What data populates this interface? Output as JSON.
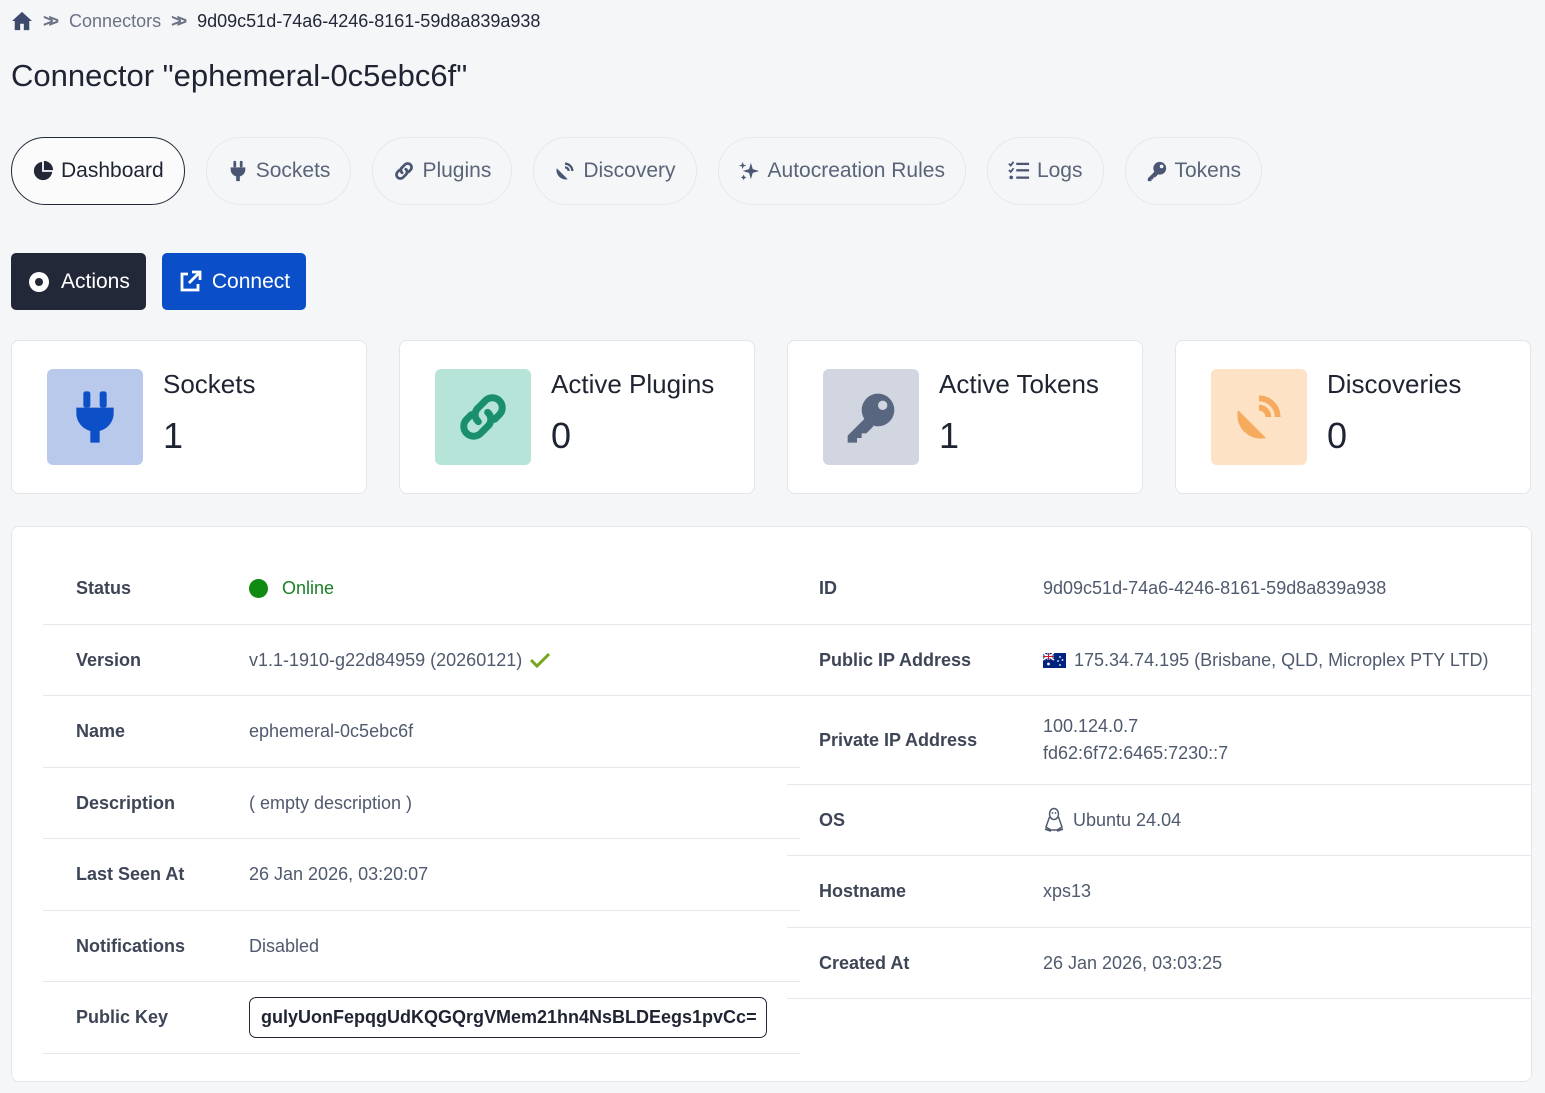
{
  "breadcrumb": {
    "connectors": "Connectors",
    "current": "9d09c51d-74a6-4246-8161-59d8a839a938"
  },
  "page_title": "Connector \"ephemeral-0c5ebc6f\"",
  "tabs": [
    {
      "label": "Dashboard",
      "icon": "pie-chart-icon"
    },
    {
      "label": "Sockets",
      "icon": "plug-icon"
    },
    {
      "label": "Plugins",
      "icon": "link-icon"
    },
    {
      "label": "Discovery",
      "icon": "satellite-dish-icon"
    },
    {
      "label": "Autocreation Rules",
      "icon": "sparkles-icon"
    },
    {
      "label": "Logs",
      "icon": "list-check-icon"
    },
    {
      "label": "Tokens",
      "icon": "key-icon"
    }
  ],
  "actions": {
    "actions_label": "Actions",
    "connect_label": "Connect"
  },
  "stats": [
    {
      "label": "Sockets",
      "value": "1",
      "icon": "plug-icon"
    },
    {
      "label": "Active Plugins",
      "value": "0",
      "icon": "link-icon"
    },
    {
      "label": "Active Tokens",
      "value": "1",
      "icon": "key-icon"
    },
    {
      "label": "Discoveries",
      "value": "0",
      "icon": "satellite-dish-icon"
    }
  ],
  "colors": {
    "dark": "#232838",
    "blue": "#0b4fc8",
    "online": "#108a10",
    "sockets_bg": "#b9c9ec",
    "plugins_bg": "#b7e4d9",
    "tokens_bg": "#d1d6e1",
    "discoveries_bg": "#fde2c6"
  },
  "details_left": {
    "status": {
      "label": "Status",
      "value": "Online"
    },
    "version": {
      "label": "Version",
      "value": "v1.1-1910-g22d84959 (20260121)"
    },
    "name": {
      "label": "Name",
      "value": "ephemeral-0c5ebc6f"
    },
    "description": {
      "label": "Description",
      "value": "( empty description )"
    },
    "last_seen": {
      "label": "Last Seen At",
      "value": "26 Jan 2026, 03:20:07"
    },
    "notifications": {
      "label": "Notifications",
      "value": "Disabled"
    },
    "public_key": {
      "label": "Public Key",
      "value": "gulyUonFepqgUdKQGQrgVMem21hn4NsBLDEegs1pvCc="
    }
  },
  "details_right": {
    "id": {
      "label": "ID",
      "value": "9d09c51d-74a6-4246-8161-59d8a839a938"
    },
    "public_ip": {
      "label": "Public IP Address",
      "value": "175.34.74.195 (Brisbane, QLD, Microplex PTY LTD)"
    },
    "private_ip": {
      "label": "Private IP Address",
      "value_1": "100.124.0.7",
      "value_2": "fd62:6f72:6465:7230::7"
    },
    "os": {
      "label": "OS",
      "value": "Ubuntu 24.04"
    },
    "hostname": {
      "label": "Hostname",
      "value": "xps13"
    },
    "created_at": {
      "label": "Created At",
      "value": "26 Jan 2026, 03:03:25"
    }
  }
}
